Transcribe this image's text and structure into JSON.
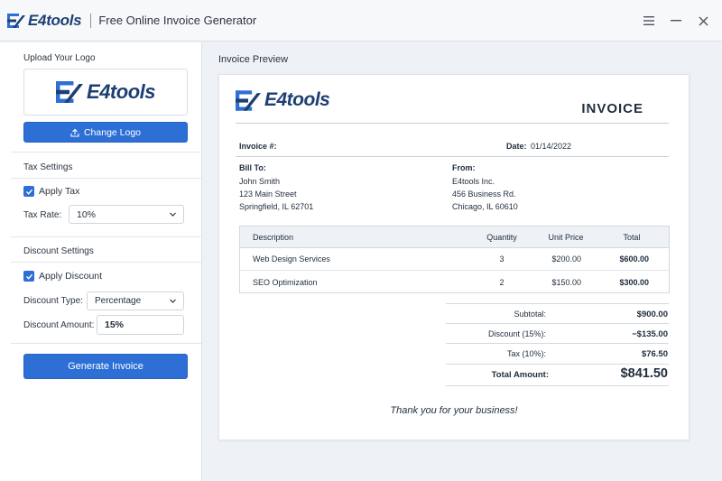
{
  "app": {
    "brand": "E4tools",
    "title": "Free Online Invoice Generator",
    "colors": {
      "brand": "#1d3f72",
      "accent": "#2d6fd4"
    }
  },
  "window_controls": {
    "icons": [
      "menu-icon",
      "minimize-icon",
      "close-icon"
    ]
  },
  "sidebar": {
    "upload_logo_label": "Upload Your Logo",
    "logo_text": "E4tools",
    "change_logo_label": "Change Logo",
    "tax_settings": {
      "heading": "Tax Settings",
      "apply_tax_label": "Apply Tax",
      "apply_tax_checked": true,
      "tax_rate_label": "Tax Rate:",
      "tax_rate_value": "10%"
    },
    "discount_settings": {
      "heading": "Discount Settings",
      "apply_discount_label": "Apply Discount",
      "apply_discount_checked": true,
      "discount_type_label": "Discount Type:",
      "discount_type_value": "Percentage",
      "discount_amount_label": "Discount Amount:",
      "discount_amount_value": "15%"
    },
    "generate_label": "Generate Invoice"
  },
  "preview": {
    "label": "Invoice Preview",
    "invoice": {
      "logo_text": "E4tools",
      "heading": "INVOICE",
      "number_label": "Invoice #:",
      "number_value": "",
      "date_label": "Date:",
      "date_value": "01/14/2022",
      "bill_to": {
        "label": "Bill To:",
        "lines": [
          "John Smith",
          "123 Main Street",
          "Springfield, IL 62701"
        ]
      },
      "from": {
        "label": "From:",
        "lines": [
          "E4tools Inc.",
          "456 Business Rd.",
          "Chicago, IL 60610"
        ]
      },
      "table": {
        "headers": {
          "description": "Description",
          "quantity": "Quantity",
          "unit_price": "Unit Price",
          "total": "Total"
        },
        "rows": [
          {
            "description": "Web Design Services",
            "quantity": "3",
            "unit_price": "$200.00",
            "total": "$600.00"
          },
          {
            "description": "SEO Optimization",
            "quantity": "2",
            "unit_price": "$150.00",
            "total": "$300.00"
          }
        ]
      },
      "totals": {
        "subtotal_label": "Subtotal:",
        "subtotal_value": "$900.00",
        "discount_label": "Discount (15%):",
        "discount_value": "−$135.00",
        "tax_label": "Tax (10%):",
        "tax_value": "$76.50",
        "total_label": "Total Amount:",
        "total_value": "$841.50"
      },
      "thank_you": "Thank you for your business!"
    }
  }
}
